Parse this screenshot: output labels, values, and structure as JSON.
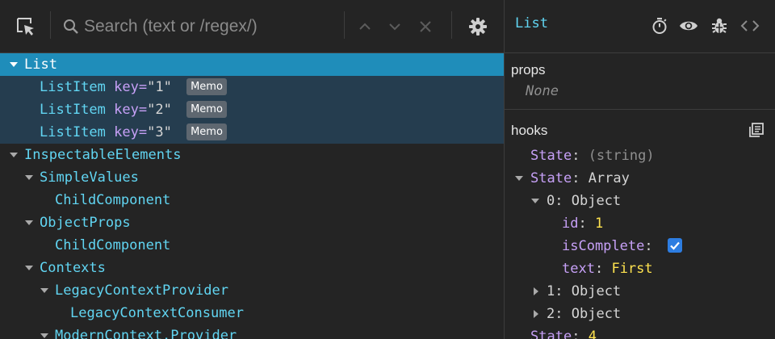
{
  "toolbar": {
    "search_placeholder": "Search (text or /regex/)",
    "icons": [
      "select-element-icon",
      "search-icon",
      "chevron-up-icon",
      "chevron-down-icon",
      "close-icon",
      "gear-icon"
    ]
  },
  "tree": {
    "rows": [
      {
        "name": "List",
        "depth": 0,
        "expanded": true,
        "selected": true
      },
      {
        "name": "ListItem",
        "key_attr": "key=",
        "key_value": "\"1\"",
        "badge": "Memo",
        "depth": 1
      },
      {
        "name": "ListItem",
        "key_attr": "key=",
        "key_value": "\"2\"",
        "badge": "Memo",
        "depth": 1
      },
      {
        "name": "ListItem",
        "key_attr": "key=",
        "key_value": "\"3\"",
        "badge": "Memo",
        "depth": 1
      },
      {
        "name": "InspectableElements",
        "depth": 0,
        "expanded": true
      },
      {
        "name": "SimpleValues",
        "depth": 1,
        "expanded": true
      },
      {
        "name": "ChildComponent",
        "depth": 2
      },
      {
        "name": "ObjectProps",
        "depth": 1,
        "expanded": true
      },
      {
        "name": "ChildComponent",
        "depth": 2
      },
      {
        "name": "Contexts",
        "depth": 1,
        "expanded": true
      },
      {
        "name": "LegacyContextProvider",
        "depth": 2,
        "expanded": true
      },
      {
        "name": "LegacyContextConsumer",
        "depth": 3
      },
      {
        "name": "ModernContext.Provider",
        "depth": 2,
        "expanded": true
      }
    ]
  },
  "inspector": {
    "title": "List",
    "icons": [
      "stopwatch-icon",
      "eye-icon",
      "bug-icon",
      "code-icon"
    ],
    "props": {
      "title": "props",
      "empty": "None"
    },
    "hooks": {
      "title": "hooks",
      "copy_icon": "copy-icon",
      "state1": {
        "key": "State",
        "colon": ":",
        "value": "(string)"
      },
      "state2": {
        "key": "State",
        "colon": ":",
        "value": "Array"
      },
      "item0": {
        "key": "0",
        "colon": ":",
        "value": "Object"
      },
      "id": {
        "key": "id",
        "colon": ":",
        "value": "1"
      },
      "isComplete": {
        "key": "isComplete",
        "colon": ":",
        "checked": true
      },
      "text": {
        "key": "text",
        "colon": ":",
        "value": "First"
      },
      "item1": {
        "key": "1",
        "colon": ":",
        "value": "Object"
      },
      "item2": {
        "key": "2",
        "colon": ":",
        "value": "Object"
      },
      "state3": {
        "key": "State",
        "colon": ":",
        "value": "4"
      }
    }
  }
}
